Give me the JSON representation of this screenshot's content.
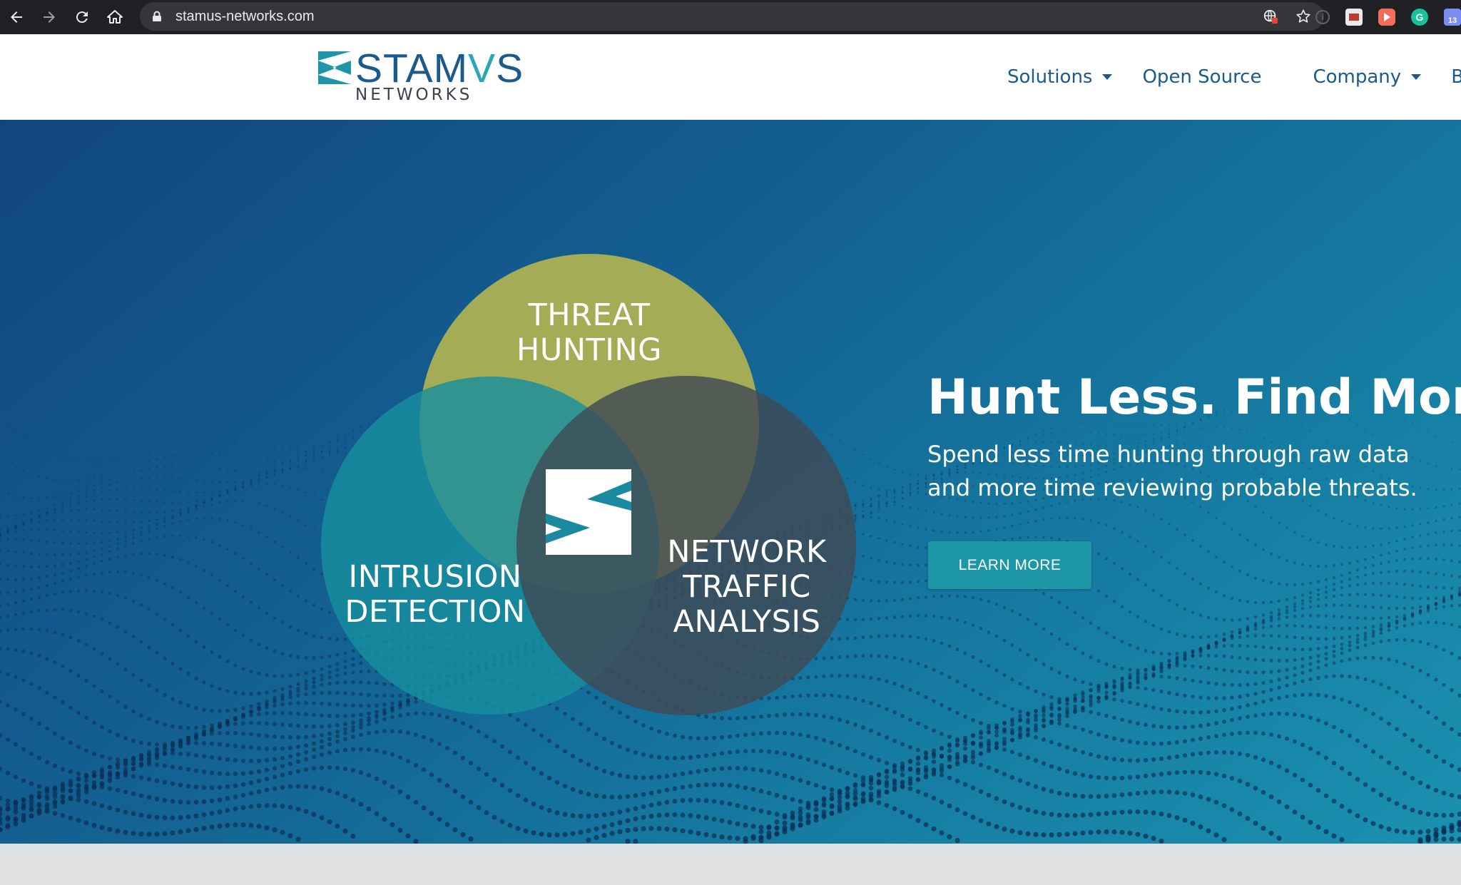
{
  "browser": {
    "url": "stamus-networks.com",
    "icons": {
      "back": "back-arrow-icon",
      "forward": "forward-arrow-icon",
      "reload": "reload-icon",
      "home": "home-icon",
      "lock": "lock-icon",
      "translate": "translate-icon",
      "bookmark": "star-icon"
    },
    "extensions": {
      "grammarly_letter": "G",
      "calendar_number": "13"
    }
  },
  "header": {
    "logo_text": "STAMVS",
    "logo_subtext": "NETWORKS",
    "nav": [
      {
        "label": "Solutions",
        "has_dropdown": true
      },
      {
        "label": "Open Source",
        "has_dropdown": false
      },
      {
        "label": "Company",
        "has_dropdown": true
      },
      {
        "label": "Blo",
        "has_dropdown": false
      }
    ]
  },
  "hero": {
    "venn": {
      "top": "THREAT\nHUNTING",
      "left": "INTRUSION\nDETECTION",
      "right": "NETWORK\nTRAFFIC\nANALYSIS"
    },
    "title": "Hunt Less. Find More.",
    "subtitle": "Spend less time hunting through raw data and more time reviewing probable threats.",
    "cta_label": "LEARN MORE"
  },
  "colors": {
    "chrome": "#202124",
    "brand_blue": "#1b5a8c",
    "brand_teal": "#2aa6b6",
    "venn_green": "#a4ac55",
    "venn_teal": "#178f9f",
    "venn_slate": "#3f4a56",
    "cta": "#1d96a6"
  }
}
